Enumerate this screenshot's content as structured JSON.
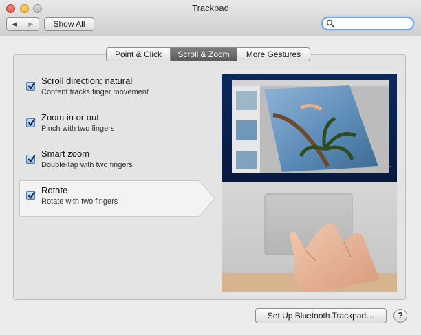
{
  "window": {
    "title": "Trackpad"
  },
  "toolbar": {
    "show_all_label": "Show All",
    "back_glyph": "◀",
    "forward_glyph": "▶",
    "search_placeholder": ""
  },
  "tabs": [
    {
      "label": "Point & Click",
      "selected": false
    },
    {
      "label": "Scroll & Zoom",
      "selected": true
    },
    {
      "label": "More Gestures",
      "selected": false
    }
  ],
  "options": [
    {
      "title": "Scroll direction: natural",
      "subtitle": "Content tracks finger movement",
      "checked": true
    },
    {
      "title": "Zoom in or out",
      "subtitle": "Pinch with two fingers",
      "checked": true
    },
    {
      "title": "Smart zoom",
      "subtitle": "Double-tap with two fingers",
      "checked": true
    },
    {
      "title": "Rotate",
      "subtitle": "Rotate with two fingers",
      "checked": true,
      "selected": true
    }
  ],
  "footer": {
    "bluetooth_label": "Set Up Bluetooth Trackpad…",
    "help_label": "?"
  },
  "colors": {
    "accent_focus": "#6fa6e4",
    "selected_tab": "#6b6b6b",
    "checkbox": "#8ab6e6"
  }
}
